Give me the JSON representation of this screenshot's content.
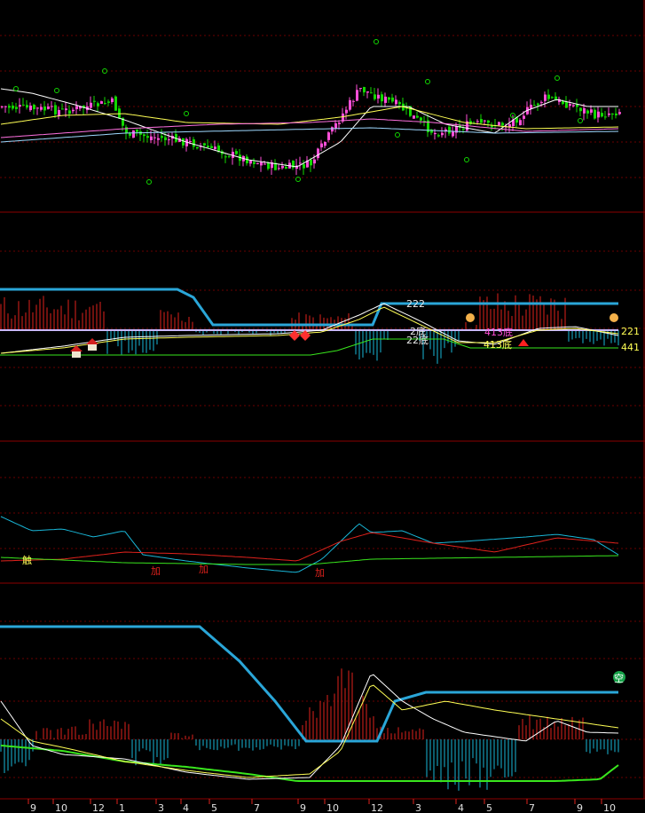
{
  "colors": {
    "background": "#000000",
    "divider": "#8b0000",
    "grid": "#6a0000",
    "up": "#ff4fd8",
    "down": "#12d800",
    "cyan": "#19b7d8",
    "blue_line": "#2aa6d8",
    "red": "#e0221c",
    "yellow": "#ffff55",
    "green": "#39e61d",
    "white": "#ffffff",
    "lilac": "#c9b7ff"
  },
  "panel2": {
    "label_222": "222",
    "label_2bottom": "2底",
    "label_22bottom": "22底",
    "label_413a": "413底",
    "label_413b": "413底",
    "label_right1": "221",
    "label_right2": "441"
  },
  "panel3": {
    "label_touch": "触",
    "label_add1": "加",
    "label_add2": "加",
    "label_add3": "加"
  },
  "panel4": {
    "badge": "空"
  },
  "x_axis": {
    "ticks": [
      "9",
      "10",
      "12",
      "1",
      "3",
      "4",
      "5",
      "7",
      "9",
      "10",
      "12",
      "3",
      "4",
      "5",
      "7",
      "9",
      "10"
    ]
  },
  "icons": [
    "house-icon",
    "diamond-icon",
    "hand-pointer-icon",
    "arrow-up-icon",
    "o-marker-icon"
  ]
}
